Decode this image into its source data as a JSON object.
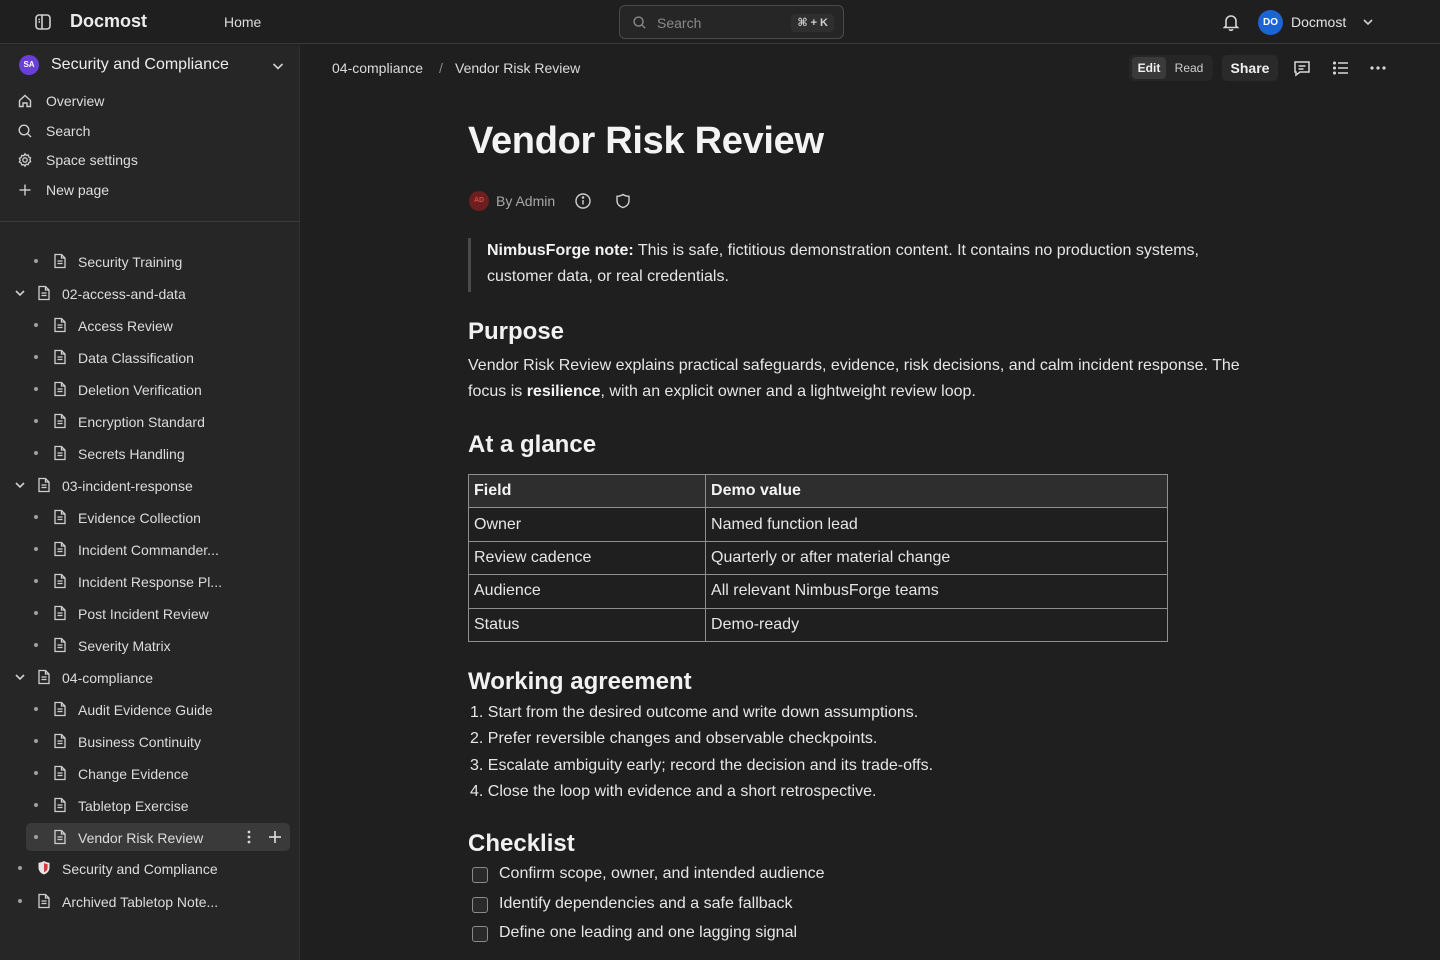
{
  "topbar": {
    "brand": "Docmost",
    "home": "Home",
    "search_placeholder": "Search",
    "search_shortcut": "⌘ + K",
    "user_initials": "DO",
    "user_name": "Docmost"
  },
  "sidebar": {
    "space": {
      "initials": "SA",
      "name": "Security and Compliance"
    },
    "nav": [
      {
        "label": "Overview",
        "icon": "home-icon"
      },
      {
        "label": "Search",
        "icon": "search-icon"
      },
      {
        "label": "Space settings",
        "icon": "gear-icon"
      },
      {
        "label": "New page",
        "icon": "plus-icon"
      }
    ],
    "tree": [
      {
        "label": "Security Training",
        "level": 2,
        "kind": "leaf"
      },
      {
        "label": "02-access-and-data",
        "level": 1,
        "kind": "expanded"
      },
      {
        "label": "Access Review",
        "level": 2,
        "kind": "leaf"
      },
      {
        "label": "Data Classification",
        "level": 2,
        "kind": "leaf"
      },
      {
        "label": "Deletion Verification",
        "level": 2,
        "kind": "leaf"
      },
      {
        "label": "Encryption Standard",
        "level": 2,
        "kind": "leaf"
      },
      {
        "label": "Secrets Handling",
        "level": 2,
        "kind": "leaf"
      },
      {
        "label": "03-incident-response",
        "level": 1,
        "kind": "expanded"
      },
      {
        "label": "Evidence Collection",
        "level": 2,
        "kind": "leaf"
      },
      {
        "label": "Incident Commander...",
        "level": 2,
        "kind": "leaf"
      },
      {
        "label": "Incident Response Pl...",
        "level": 2,
        "kind": "leaf"
      },
      {
        "label": "Post Incident Review",
        "level": 2,
        "kind": "leaf"
      },
      {
        "label": "Severity Matrix",
        "level": 2,
        "kind": "leaf"
      },
      {
        "label": "04-compliance",
        "level": 1,
        "kind": "expanded"
      },
      {
        "label": "Audit Evidence Guide",
        "level": 2,
        "kind": "leaf"
      },
      {
        "label": "Business Continuity",
        "level": 2,
        "kind": "leaf"
      },
      {
        "label": "Change Evidence",
        "level": 2,
        "kind": "leaf"
      },
      {
        "label": "Tabletop Exercise",
        "level": 2,
        "kind": "leaf"
      },
      {
        "label": "Vendor Risk Review",
        "level": 2,
        "kind": "leaf",
        "active": true
      },
      {
        "label": "Security and Compliance",
        "level": 1,
        "kind": "leaf",
        "icon": "shield-emoji-icon"
      },
      {
        "label": "Archived Tabletop Note...",
        "level": 1,
        "kind": "leaf"
      }
    ]
  },
  "header": {
    "breadcrumb": [
      "04-compliance",
      "Vendor Risk Review"
    ],
    "breadcrumb_sep": "/",
    "mode_edit": "Edit",
    "mode_read": "Read",
    "share": "Share"
  },
  "doc": {
    "title": "Vendor Risk Review",
    "author_initials": "AD",
    "byline": "By Admin",
    "callout_bold": "NimbusForge note:",
    "callout_text": " This is safe, fictitious demonstration content. It contains no production systems, customer data, or real credentials.",
    "purpose_heading": "Purpose",
    "purpose_a": "Vendor Risk Review explains practical safeguards, evidence, risk decisions, and calm incident response. The focus is ",
    "purpose_bold": "resilience",
    "purpose_b": ", with an explicit owner and a lightweight review loop.",
    "glance_heading": "At a glance",
    "table": {
      "headers": [
        "Field",
        "Demo value"
      ],
      "rows": [
        [
          "Owner",
          "Named function lead"
        ],
        [
          "Review cadence",
          "Quarterly or after material change"
        ],
        [
          "Audience",
          "All relevant NimbusForge teams"
        ],
        [
          "Status",
          "Demo-ready"
        ]
      ]
    },
    "agreement_heading": "Working agreement",
    "agreement": [
      "1. Start from the desired outcome and write down assumptions.",
      "2. Prefer reversible changes and observable checkpoints.",
      "3. Escalate ambiguity early; record the decision and its trade-offs.",
      "4. Close the loop with evidence and a short retrospective."
    ],
    "checklist_heading": "Checklist",
    "checklist": [
      "Confirm scope, owner, and intended audience",
      "Identify dependencies and a safe fallback",
      "Define one leading and one lagging signal"
    ]
  },
  "colors": {
    "background": "#1f1f1f",
    "sidebar": "#262626",
    "accent": "#1c63d6",
    "space_avatar": "#6a3fd8"
  }
}
